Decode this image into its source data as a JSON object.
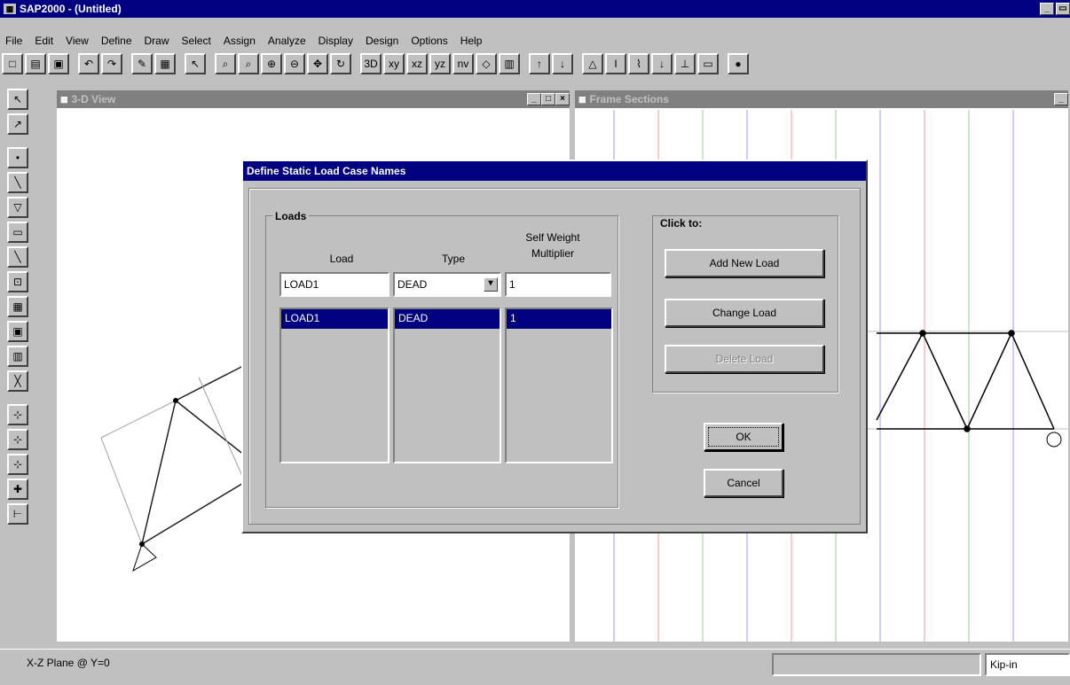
{
  "app": {
    "title": "SAP2000 - (Untitled)"
  },
  "menu": [
    "File",
    "Edit",
    "View",
    "Define",
    "Draw",
    "Select",
    "Assign",
    "Analyze",
    "Display",
    "Design",
    "Options",
    "Help"
  ],
  "toolbar_icons": [
    "new-icon",
    "open-icon",
    "save-icon",
    "undo-icon",
    "redo-icon",
    "pencil-icon",
    "lock-icon",
    "pointer-icon",
    "zoom-window-icon",
    "zoom-restore-icon",
    "zoom-in-icon",
    "zoom-out-icon",
    "pan-icon",
    "refresh-icon",
    "view-3d-icon",
    "view-xy-icon",
    "view-xz-icon",
    "view-yz-icon",
    "view-nv-icon",
    "element-shrink-icon",
    "set-elements-icon",
    "up-arrow-icon",
    "down-arrow-icon",
    "restrain-icon",
    "section-icon",
    "springs-icon",
    "point-load-icon",
    "frame-load-icon",
    "area-load-icon",
    "run-icon"
  ],
  "left_toolbar_icons": [
    "pointer-icon",
    "reshape-icon",
    "joint-icon",
    "frame-icon",
    "shell-icon",
    "rectangular-shell-icon",
    "line-icon",
    "quad-icon",
    "grid-icon",
    "section-cut-icon",
    "solid-icon",
    "brace-icon",
    "snap-joints-icon",
    "snap-ends-icon",
    "snap-intersection-icon",
    "snap-perpendicular-icon",
    "snap-lines-icon"
  ],
  "window_3d": {
    "title": "3-D View"
  },
  "window_frame": {
    "title": "Frame Sections"
  },
  "dialog": {
    "title": "Define Static Load Case Names",
    "loads_group": "Loads",
    "col_load": "Load",
    "col_type": "Type",
    "col_selfweight_1": "Self Weight",
    "col_selfweight_2": "Multiplier",
    "load_value": "LOAD1",
    "type_value": "DEAD",
    "multiplier_value": "1",
    "list": [
      {
        "load": "LOAD1",
        "type": "DEAD",
        "multiplier": "1"
      }
    ],
    "click_group": "Click to:",
    "add_button": "Add New Load",
    "change_button": "Change Load",
    "delete_button": "Delete Load",
    "ok_button": "OK",
    "cancel_button": "Cancel"
  },
  "status": {
    "text": "X-Z Plane @ Y=0",
    "units": "Kip-in"
  },
  "colors": {
    "titlebar": "#000080",
    "face": "#c0c0c0",
    "canvas": "#ffffff"
  }
}
